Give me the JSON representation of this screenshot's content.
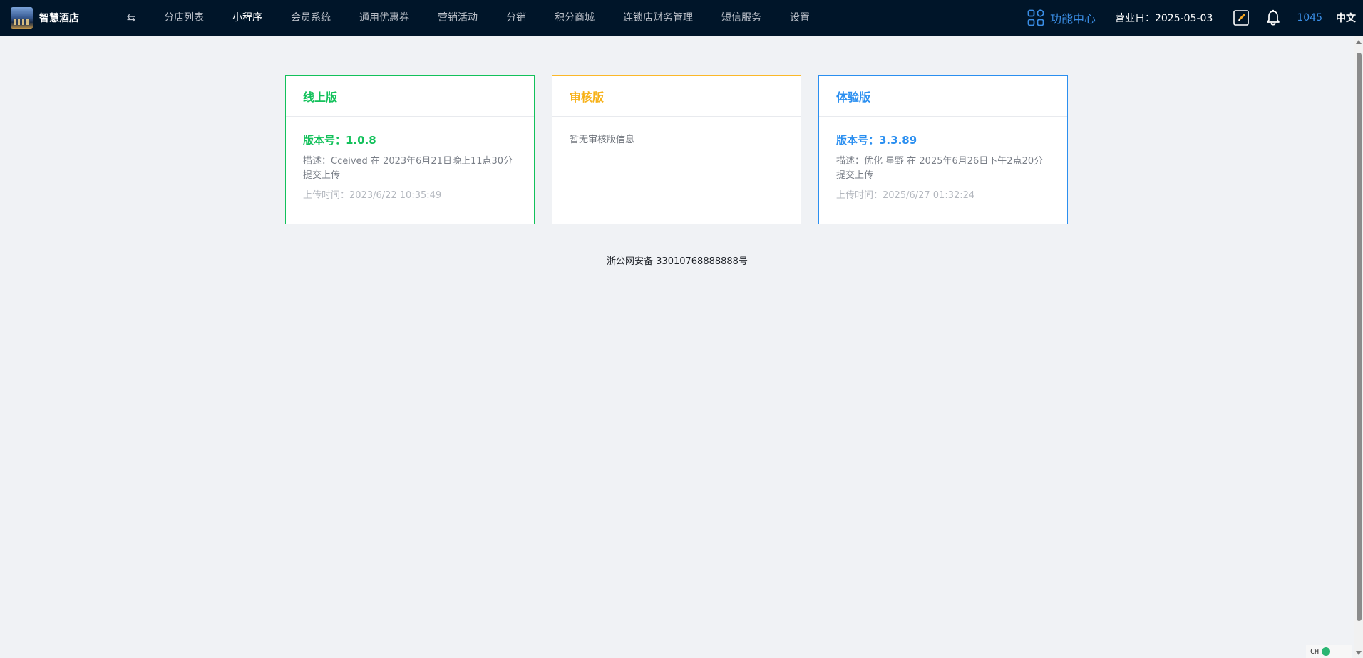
{
  "brand": {
    "name": "智慧酒店"
  },
  "nav": {
    "toggle_icon": "⇆",
    "items": [
      {
        "label": "分店列表",
        "active": false
      },
      {
        "label": "小程序",
        "active": true
      },
      {
        "label": "会员系统",
        "active": false
      },
      {
        "label": "通用优惠券",
        "active": false
      },
      {
        "label": "营销活动",
        "active": false
      },
      {
        "label": "分销",
        "active": false
      },
      {
        "label": "积分商城",
        "active": false
      },
      {
        "label": "连锁店财务管理",
        "active": false
      },
      {
        "label": "短信服务",
        "active": false
      },
      {
        "label": "设置",
        "active": false
      }
    ]
  },
  "header_right": {
    "function_center": "功能中心",
    "business_date": "营业日：2025-05-03",
    "user_id": "1045",
    "language": "中文"
  },
  "cards": {
    "online": {
      "title": "线上版",
      "version": "版本号：1.0.8",
      "description": "描述：Cceived 在 2023年6月21日晚上11点30分提交上传",
      "upload_time": "上传时间：2023/6/22 10:35:49"
    },
    "review": {
      "title": "审核版",
      "empty_message": "暂无审核版信息"
    },
    "trial": {
      "title": "体验版",
      "version": "版本号：3.3.89",
      "description": "描述：优化 星野 在 2025年6月26日下午2点20分提交上传",
      "upload_time": "上传时间：2025/6/27 01:32:24"
    }
  },
  "footer": {
    "icp": "浙公网安备 33010768888888号"
  },
  "tray": {
    "ime": "CH"
  },
  "colors": {
    "topbar_bg": "#001529",
    "accent_blue": "#2b8ff0",
    "online_green": "#13c15b",
    "review_orange": "#f7b21a",
    "page_bg": "#f0f2f5"
  }
}
